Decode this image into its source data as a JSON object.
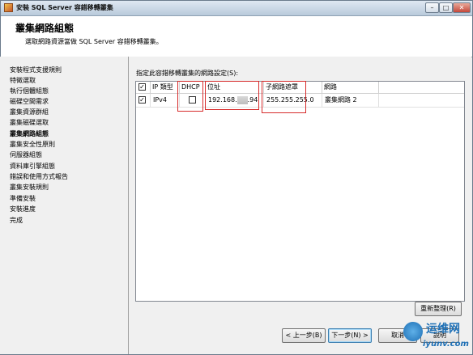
{
  "window": {
    "title": "安裝 SQL Server 容錯移轉叢集",
    "minimize": "–",
    "maximize": "□",
    "close": "✕"
  },
  "header": {
    "title": "叢集網路組態",
    "description": "選取網路資源當做 SQL Server 容錯移轉叢集。"
  },
  "nav": {
    "items": [
      {
        "label": "安裝程式支援規則",
        "active": false
      },
      {
        "label": "特徵選取",
        "active": false
      },
      {
        "label": "執行個體組態",
        "active": false
      },
      {
        "label": "磁碟空間需求",
        "active": false
      },
      {
        "label": "叢集資源群組",
        "active": false
      },
      {
        "label": "叢集磁碟選取",
        "active": false
      },
      {
        "label": "叢集網路組態",
        "active": true
      },
      {
        "label": "叢集安全性原則",
        "active": false
      },
      {
        "label": "伺服器組態",
        "active": false
      },
      {
        "label": "資料庫引擎組態",
        "active": false
      },
      {
        "label": "錯誤和使用方式報告",
        "active": false
      },
      {
        "label": "叢集安裝規則",
        "active": false
      },
      {
        "label": "準備安裝",
        "active": false
      },
      {
        "label": "安裝進度",
        "active": false
      },
      {
        "label": "完成",
        "active": false
      }
    ]
  },
  "main": {
    "settings_label": "指定此容錯移轉叢集的網路設定(S):",
    "columns": [
      "IP 類型",
      "DHCP",
      "位址",
      "子網路遮罩",
      "網路"
    ],
    "header_checked": true,
    "rows": [
      {
        "selected": true,
        "ip_type": "IPv4",
        "dhcp": false,
        "address_prefix": "192.168.",
        "address_suffix": ".94",
        "subnet": "255.255.255.0",
        "network": "叢集網路 2"
      }
    ],
    "refresh_button": "重新整理(R)"
  },
  "footer": {
    "back": "< 上一步(B)",
    "next": "下一步(N) >",
    "cancel": "取消",
    "help": "說明"
  },
  "watermark": {
    "cn": "运维网",
    "en": "iyunv.com"
  }
}
